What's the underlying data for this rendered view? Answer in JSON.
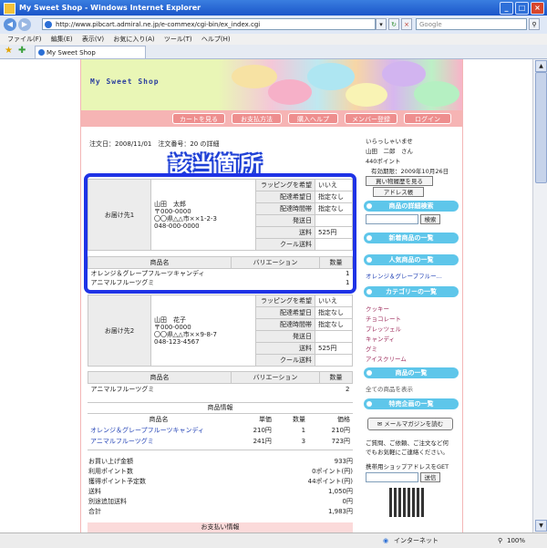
{
  "window": {
    "title": "My Sweet Shop - Windows Internet Explorer",
    "url": "http://www.pibcart.admiral.ne.jp/e-commex/cgi-bin/ex_index.cgi",
    "search_placeholder": "Google",
    "menu": [
      "ファイル(F)",
      "編集(E)",
      "表示(V)",
      "お気に入り(A)",
      "ツール(T)",
      "ヘルプ(H)"
    ],
    "tab_label": "My Sweet Shop",
    "status_zone": "インターネット",
    "zoom": "100%"
  },
  "shop": {
    "logo": "My Sweet Shop",
    "nav": [
      "カートを見る",
      "お支払方法",
      "購入ヘルプ",
      "メンバー登録",
      "ログイン"
    ]
  },
  "order": {
    "order_line": "注文日：2008/11/01　注文番号：20 の詳細",
    "callout": "該当箇所",
    "shipping_labels": {
      "wrapping": "ラッピングを希望",
      "date": "配達希望日",
      "time": "配達時間帯",
      "ship_date": "発送日",
      "postage": "送料",
      "cool": "クール送料"
    },
    "columns": {
      "product": "商品名",
      "variation": "バリエーション",
      "qty": "数量",
      "price": "単価",
      "subtotal": "価格"
    },
    "dest1": {
      "label": "お届け先1",
      "name": "山田　太郎",
      "zip": "〒000-0000",
      "address": "〇〇県△△市××1-2-3",
      "phone": "048-000-0000",
      "wrapping": "いいえ",
      "date": "指定なし",
      "time": "指定なし",
      "ship_date": "",
      "postage": "525円",
      "cool": "",
      "items": [
        {
          "name": "オレンジ＆グレープフルーツキャンディ",
          "variation": "",
          "qty": "1"
        },
        {
          "name": "アニマルフルーツグミ",
          "variation": "",
          "qty": "1"
        }
      ]
    },
    "dest2": {
      "label": "お届け先2",
      "name": "山田　花子",
      "zip": "〒000-0000",
      "address": "〇〇県△△市××9-8-7",
      "phone": "048-123-4567",
      "wrapping": "いいえ",
      "date": "指定なし",
      "time": "指定なし",
      "ship_date": "",
      "postage": "525円",
      "cool": "",
      "items": [
        {
          "name": "アニマルフルーツグミ",
          "variation": "",
          "qty": "2"
        }
      ]
    },
    "product_info": {
      "heading": "商品情報",
      "rows": [
        {
          "name": "オレンジ＆グレープフルーツキャンディ",
          "price": "210円",
          "qty": "1",
          "subtotal": "210円"
        },
        {
          "name": "アニマルフルーツグミ",
          "price": "241円",
          "qty": "3",
          "subtotal": "723円"
        }
      ]
    },
    "summary": [
      {
        "k": "お買い上げ金額",
        "v": "933円"
      },
      {
        "k": "利用ポイント数",
        "v": "0ポイント(円)"
      },
      {
        "k": "獲得ポイント予定数",
        "v": "44ポイント(円)"
      },
      {
        "k": "送料",
        "v": "1,050円"
      },
      {
        "k": "別途追加送料",
        "v": "0円"
      },
      {
        "k": "合計",
        "v": "1,983円"
      }
    ],
    "payment_heading": "お支払い情報"
  },
  "sidebar": {
    "greeting": "いらっしゃいませ",
    "user": "山田　二郎　さん",
    "points": "440ポイント",
    "expiry": "有効期限：2009年10月26日",
    "history_btn": "買い物履歴を見る",
    "address_btn": "アドレス帳",
    "detail_search": "商品の詳細検索",
    "search_btn": "検索",
    "new_items": "新着商品の一覧",
    "popular_items": "人気商品の一覧",
    "popular_link": "オレンジ＆グレープフルー...",
    "categories": "カテゴリーの一覧",
    "category_list": [
      "クッキー",
      "チョコレート",
      "プレッツェル",
      "キャンディ",
      "グミ",
      "アイスクリーム"
    ],
    "product_list": "商品の一覧",
    "all_products": "全ての商品を表示",
    "specials": "特売企画の一覧",
    "mail_btn": "メールマガジンを読む",
    "contact_text_1": "ご質問、ご依頼、ご注文など何",
    "contact_text_2": "でもお気軽にご連絡ください。",
    "mobile_text": "携帯用ショップアドレスをGET",
    "send_btn": "送信"
  }
}
